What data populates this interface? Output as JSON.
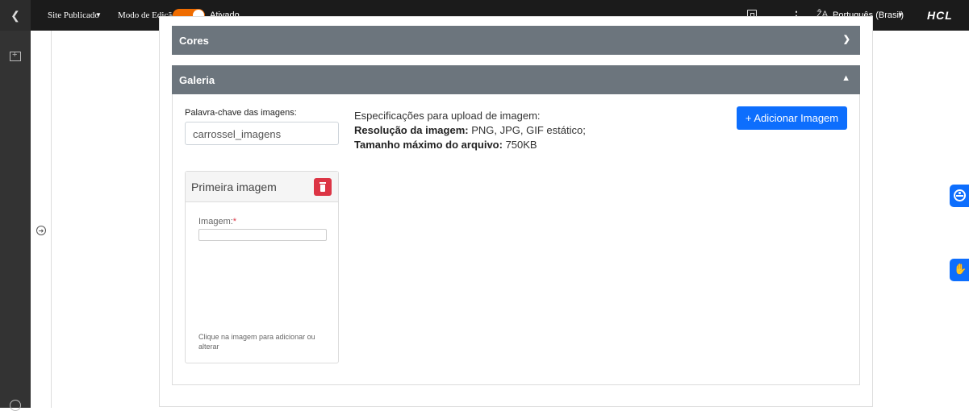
{
  "topbar": {
    "back_icon": "chevron-left-icon",
    "site_status": "Site Publicado",
    "edit_mode_label": "Modo de Edição:",
    "edit_mode_value": "Ativado",
    "edit_mode_color": "#ef6c00",
    "preview_icon": "preview-icon",
    "more_icon": "kebab-icon",
    "language_icon": "translate-icon",
    "language": "Português (Brasil)",
    "brand": "HCL"
  },
  "left_rail": {
    "add_icon": "add-panel-icon",
    "globe_icon": "globe-icon",
    "expand_icon": "arrow-right-circle-icon"
  },
  "accordions": {
    "cores": {
      "label": "Cores",
      "expanded": false
    },
    "galeria": {
      "label": "Galeria",
      "expanded": true
    }
  },
  "gallery": {
    "keyword_label": "Palavra-chave das imagens:",
    "keyword_value": "carrossel_imagens",
    "spec_title": "Especificações para upload de imagem:",
    "spec_resolution_label": "Resolução da imagem:",
    "spec_resolution_value": " PNG, JPG, GIF estático;",
    "spec_size_label": "Tamanho máximo do arquivo:",
    "spec_size_value": " 750KB",
    "add_button": "+ Adicionar Imagem",
    "add_button_color": "#0d6efd",
    "image_card": {
      "title": "Primeira imagem",
      "delete_icon": "trash-icon",
      "delete_color": "#dc3545",
      "image_label": "Imagem:",
      "required_mark": "*",
      "hint": "Clique na imagem para adicionar ou alterar"
    }
  },
  "floaters": {
    "accessibility_icon": "accessibility-icon",
    "sign_language_icon": "sign-language-hands-icon",
    "color": "#0d6efd"
  }
}
